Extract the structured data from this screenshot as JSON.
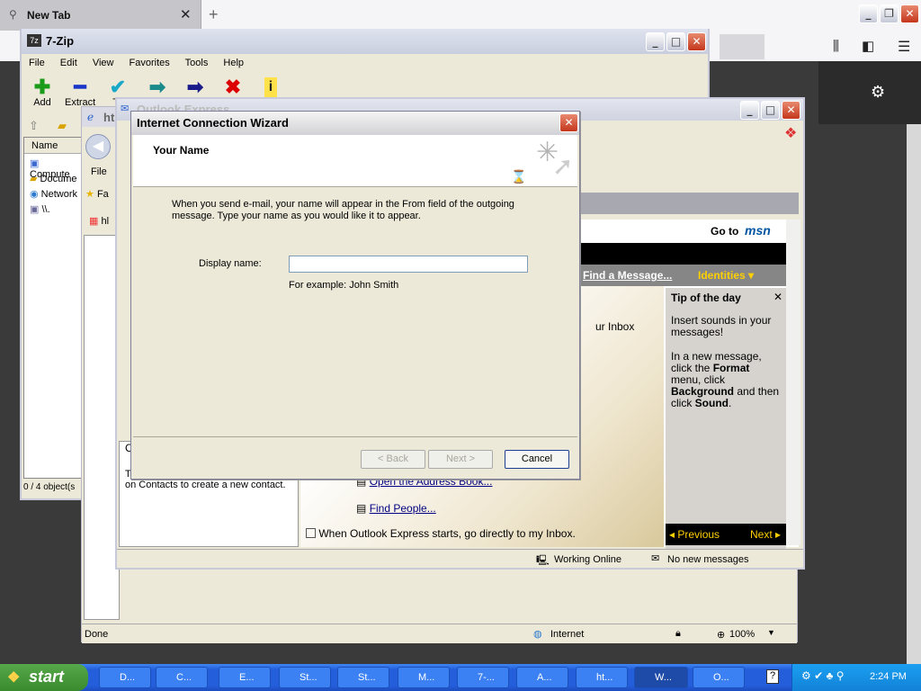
{
  "firefox": {
    "tab_title": "New Tab"
  },
  "sevenzip": {
    "title": "7-Zip",
    "menu": [
      "File",
      "Edit",
      "View",
      "Favorites",
      "Tools",
      "Help"
    ],
    "tools": [
      "Add",
      "Extract",
      "Te"
    ],
    "col_name": "Name",
    "items": [
      "Compute",
      "Docume",
      "Network",
      "\\\\."
    ],
    "status": "0 / 4 object(s"
  },
  "ie": {
    "address_frag": "ht",
    "menu_file": "File",
    "fav_frag": "Fa",
    "hl_frag": "hl",
    "status_done": "Done",
    "status_zone": "Internet",
    "zoom": "100%"
  },
  "outlook": {
    "title": "Outlook Express",
    "go_to": "Go to",
    "msn": "msn",
    "find_message": "Find a Message...",
    "identities": "Identities",
    "inbox_frag": "ur Inbox",
    "address_book": "Open the Address Book...",
    "find_people": "Find People...",
    "contacts_text": "on Contacts to create a new contact.",
    "contacts_frag": "T",
    "c_frag": "C",
    "startup_check": "When Outlook Express starts, go directly to my Inbox.",
    "status_online": "Working Online",
    "status_messages": "No new messages",
    "tip": {
      "title": "Tip of the day",
      "line1": "Insert sounds in your messages!",
      "line2a": "In a new message, click the ",
      "b1": "Format",
      "line2b": " menu, click ",
      "b2": "Background",
      "line2c": " and then click ",
      "b3": "Sound",
      "line2d": ".",
      "prev": "Previous",
      "next": "Next"
    }
  },
  "wizard": {
    "title": "Internet Connection Wizard",
    "heading": "Your Name",
    "intro": "When you send e-mail, your name will appear in the From field of the outgoing message. Type your name as you would like it to appear.",
    "display_label": "Display name:",
    "display_value": "",
    "example": "For example: John Smith",
    "back": "< Back",
    "next": "Next >",
    "cancel": "Cancel"
  },
  "taskbar": {
    "start": "start",
    "items": [
      "D...",
      "C...",
      "E...",
      "St...",
      "St...",
      "M...",
      "7-...",
      "A...",
      "ht...",
      "W...",
      "O..."
    ],
    "clock": "2:24 PM"
  }
}
